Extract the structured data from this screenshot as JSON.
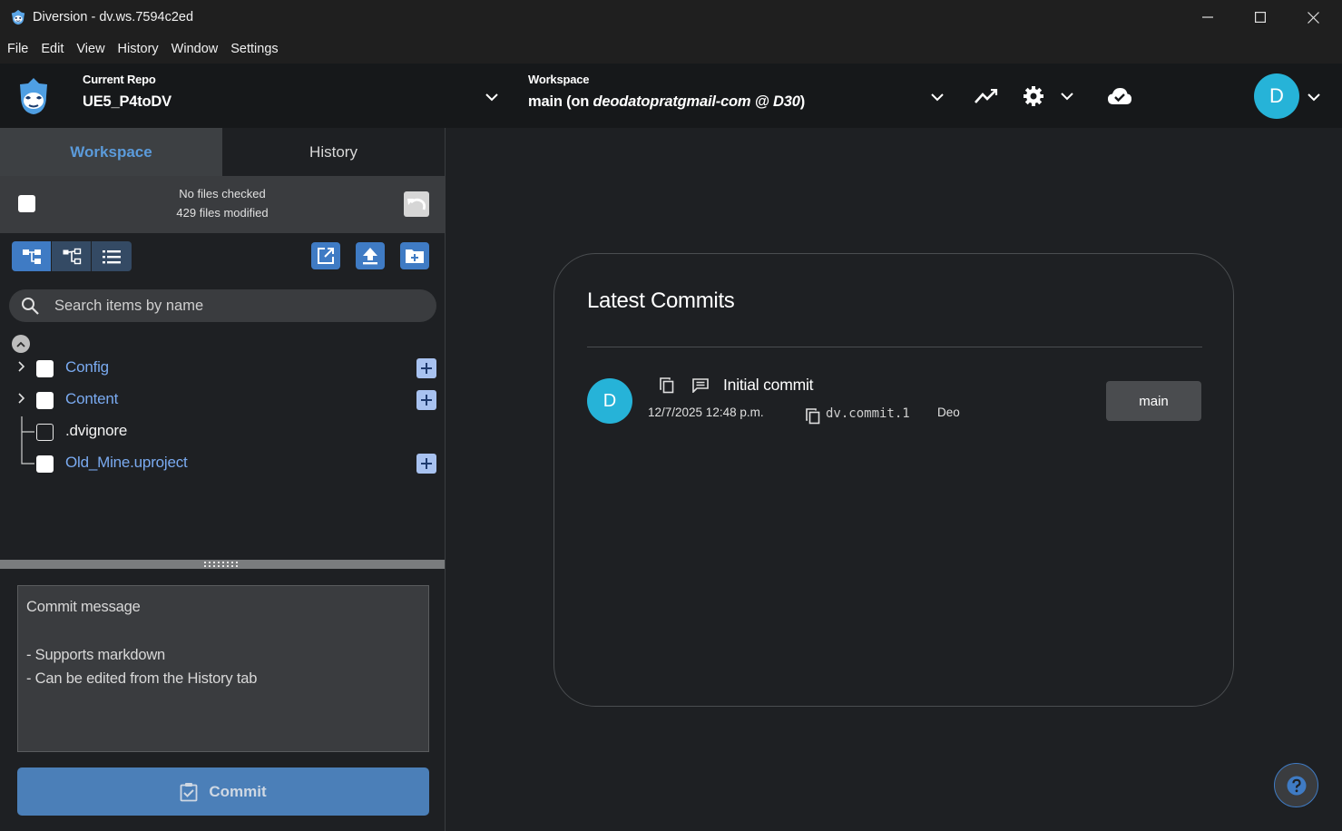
{
  "window": {
    "title": "Diversion - dv.ws.7594c2ed"
  },
  "menu": [
    "File",
    "Edit",
    "View",
    "History",
    "Window",
    "Settings"
  ],
  "repo": {
    "label": "Current Repo",
    "name": "UE5_P4toDV"
  },
  "workspace": {
    "label": "Workspace",
    "branch": "main",
    "prefix": "(on ",
    "owner": "deodatopratgmail-com @ D30",
    "suffix": ")"
  },
  "user": {
    "initial": "D"
  },
  "tabs": [
    {
      "label": "Workspace",
      "active": true
    },
    {
      "label": "History",
      "active": false
    }
  ],
  "status": {
    "checked": "No files checked",
    "modified": "429 files modified"
  },
  "search": {
    "placeholder": "Search items by name"
  },
  "tree": [
    {
      "name": "Config",
      "expandable": true,
      "modified": true
    },
    {
      "name": "Content",
      "expandable": true,
      "modified": true
    },
    {
      "name": ".dvignore",
      "expandable": false,
      "modified": false
    },
    {
      "name": "Old_Mine.uproject",
      "expandable": false,
      "modified": true
    }
  ],
  "commit": {
    "placeholder_line1": "Commit message",
    "placeholder_line2": "- Supports markdown",
    "placeholder_line3": "- Can be edited from the History tab",
    "button_label": "Commit"
  },
  "latest_commits": {
    "title": "Latest Commits",
    "items": [
      {
        "author_initial": "D",
        "message": "Initial commit",
        "date": "12/7/2025 12:48 p.m.",
        "id": "dv.commit.1",
        "author": "Deo",
        "branch": "main"
      }
    ]
  },
  "colors": {
    "accent": "#3f7bc4",
    "modified_text": "#7aaaf0",
    "avatar": "#26b3d8",
    "active_tab_text": "#5b9bdb"
  }
}
